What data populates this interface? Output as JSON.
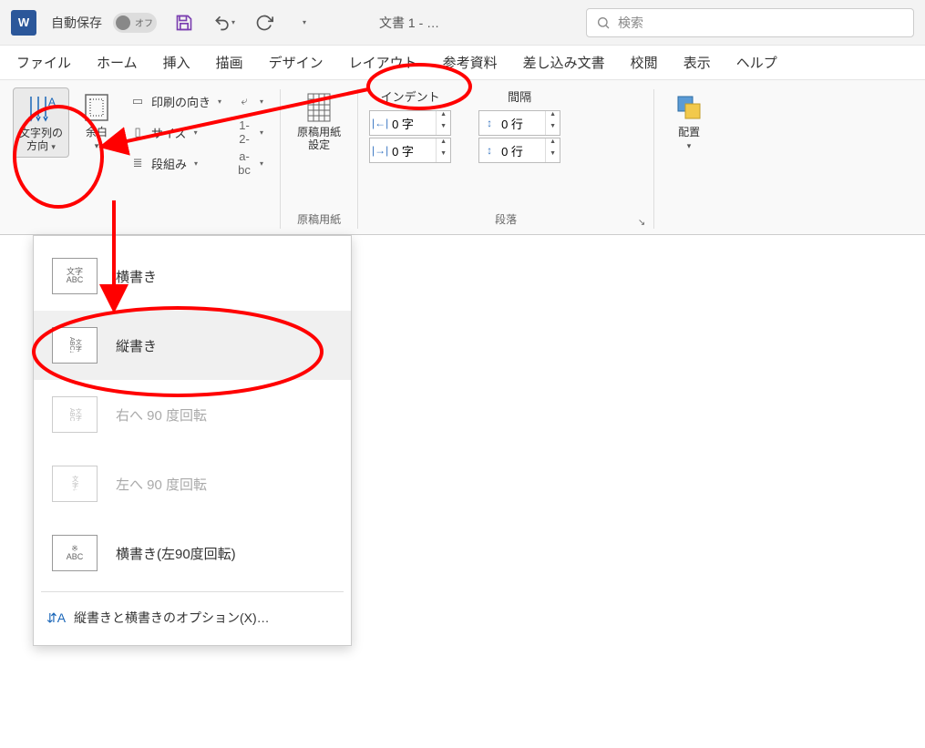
{
  "titlebar": {
    "autosave_label": "自動保存",
    "autosave_state": "オフ",
    "doc_title": "文書 1 - …",
    "search_placeholder": "検索"
  },
  "tabs": {
    "items": [
      "ファイル",
      "ホーム",
      "挿入",
      "描画",
      "デザイン",
      "レイアウト",
      "参考資料",
      "差し込み文書",
      "校閲",
      "表示",
      "ヘルプ"
    ]
  },
  "ribbon": {
    "text_direction": {
      "label_line1": "文字列の",
      "label_line2": "方向"
    },
    "margins": "余白",
    "orientation": "印刷の向き",
    "size": "サイズ",
    "columns": "段組み",
    "breaks": "区",
    "line_numbers": "行",
    "hyphenation": "ハイ",
    "manuscript": {
      "btn": "原稿用紙\n設定",
      "group": "原稿用紙"
    },
    "indent_header": "インデント",
    "spacing_header": "間隔",
    "indent_left": "0 字",
    "indent_right": "0 字",
    "spacing_before": "0 行",
    "spacing_after": "0 行",
    "paragraph_group": "段落",
    "arrange": "配置"
  },
  "dropdown": {
    "horizontal": "横書き",
    "vertical": "縦書き",
    "rotate_right": "右へ 90 度回転",
    "rotate_left": "左へ 90 度回転",
    "horizontal_rotated": "横書き(左90度回転)",
    "options": "縦書きと横書きのオプション(X)…"
  }
}
